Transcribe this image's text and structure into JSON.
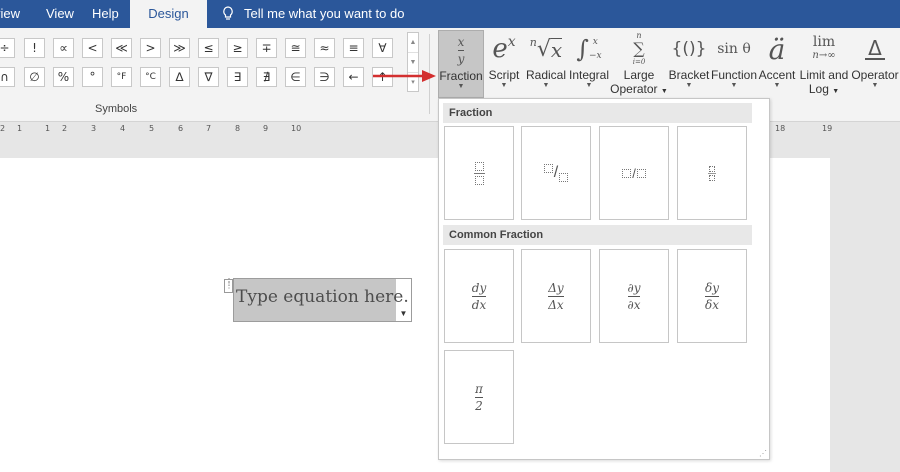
{
  "tabs": [
    {
      "label": "view"
    },
    {
      "label": "View"
    },
    {
      "label": "Help"
    },
    {
      "label": "Design"
    }
  ],
  "tell_me": "Tell me what you want to do",
  "symbols": {
    "row1": [
      "÷",
      "!",
      "∝",
      "<",
      "≪",
      ">",
      "≫",
      "≤",
      "≥",
      "∓",
      "≅",
      "≈",
      "≡",
      "∀"
    ],
    "row2": [
      "∩",
      "∅",
      "%",
      "°",
      "°F",
      "°C",
      "∆",
      "∇",
      "∃",
      "∄",
      "∈",
      "∋",
      "←",
      "↑"
    ],
    "group_label": "Symbols"
  },
  "structures": [
    {
      "label": "Fraction",
      "label2": ""
    },
    {
      "label": "Script",
      "label2": ""
    },
    {
      "label": "Radical",
      "label2": ""
    },
    {
      "label": "Integral",
      "label2": ""
    },
    {
      "label": "Large",
      "label2": "Operator"
    },
    {
      "label": "Bracket",
      "label2": ""
    },
    {
      "label": "Function",
      "label2": ""
    },
    {
      "label": "Accent",
      "label2": ""
    },
    {
      "label": "Limit and",
      "label2": "Log"
    },
    {
      "label": "Operator",
      "label2": ""
    }
  ],
  "structure_icons": {
    "script": {
      "base": "e",
      "sup": "x"
    },
    "radical": {
      "index": "n",
      "radicand": "x"
    },
    "integral": {
      "upper": "x",
      "lower": "−x"
    },
    "large_operator": {
      "upper": "n",
      "lower": "i=0"
    },
    "bracket": "{()}",
    "function": "sin θ",
    "accent": "ä",
    "limit": {
      "top": "lim",
      "bottom": "n→∞"
    },
    "operator": "Δ"
  },
  "fraction_icon": {
    "num": "x",
    "den": "y"
  },
  "ruler": {
    "ticks": [
      "2",
      "1",
      "1",
      "2",
      "3",
      "4",
      "5",
      "6",
      "7",
      "8",
      "9",
      "10",
      "18",
      "19"
    ]
  },
  "equation": {
    "placeholder": "Type equation here."
  },
  "gallery": {
    "section1": "Fraction",
    "section2": "Common Fraction",
    "common": [
      {
        "num": "dy",
        "den": "dx"
      },
      {
        "num": "Δy",
        "den": "Δx"
      },
      {
        "num": "∂y",
        "den": "∂x"
      },
      {
        "num": "δy",
        "den": "δx"
      },
      {
        "num": "π",
        "den": "2"
      }
    ]
  },
  "colors": {
    "accent": "#2b579a",
    "arrow": "#d32f2f"
  }
}
